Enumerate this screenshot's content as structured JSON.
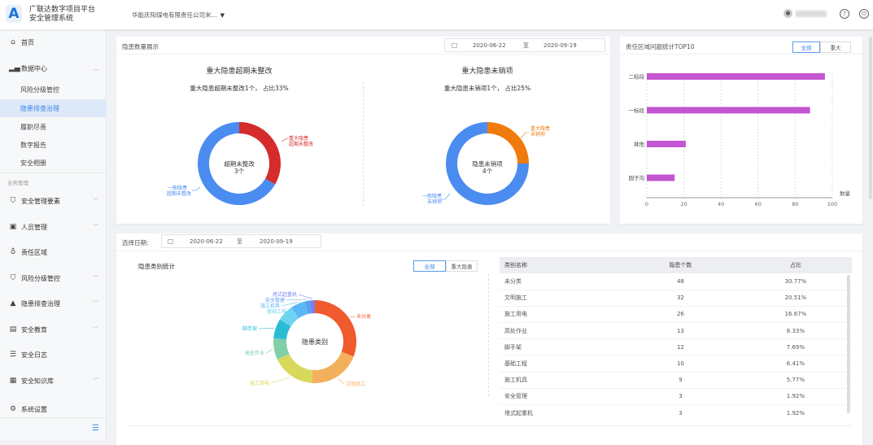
{
  "header": {
    "logo_letter": "A",
    "title_line1": "广联达数字项目平台",
    "title_line2": "安全管理系统",
    "company": "华能庆阳煤电有限责任公司米...",
    "help_icon": "?",
    "power_icon": "⏻"
  },
  "sidebar": {
    "home": "首页",
    "data_center": "数据中心",
    "sub_items": [
      "风险分级管控",
      "隐患排查治理",
      "履职尽责",
      "数字报告",
      "安全相册"
    ],
    "group_label": "业务管理",
    "items": [
      "安全管理要素",
      "人员管理",
      "责任区域",
      "风险分级管控",
      "隐患排查治理",
      "安全教育",
      "安全日志",
      "安全知识库",
      "系统设置"
    ]
  },
  "hazard_display": {
    "title": "隐患数量展示",
    "date_from": "2020-06-22",
    "date_sep": "至",
    "date_to": "2020-09-19",
    "left": {
      "title": "重大隐患超期未整改",
      "summary": "重大隐患超期未整改1个， 占比33%",
      "center_line1": "超期未整改",
      "center_line2": "3个",
      "major_label1": "重大隐患",
      "major_label2": "超期未整改",
      "general_label1": "一般隐患",
      "general_label2": "超期未整改"
    },
    "right": {
      "title": "重大隐患未销项",
      "summary": "重大隐患未销项1个， 占比25%",
      "center_line1": "隐患未销项",
      "center_line2": "4个",
      "major_label1": "重大隐患",
      "major_label2": "未销项",
      "general_label1": "一般隐患",
      "general_label2": "未销项"
    }
  },
  "area_top10": {
    "title": "责任区域问题统计TOP10",
    "seg": [
      "全部",
      "重大"
    ]
  },
  "category": {
    "date_label": "选择日期:",
    "date_from": "2020-06-22",
    "date_sep": "至",
    "date_to": "2020-09-19",
    "title": "隐患类别统计",
    "seg": [
      "全部",
      "重大隐患"
    ],
    "center": "隐患类别",
    "columns": [
      "类别名称",
      "隐患个数",
      "占比"
    ],
    "rows": [
      [
        "未分类",
        "48",
        "30.77%"
      ],
      [
        "文明施工",
        "32",
        "20.51%"
      ],
      [
        "施工用电",
        "26",
        "16.67%"
      ],
      [
        "高处作业",
        "13",
        "8.33%"
      ],
      [
        "脚手架",
        "12",
        "7.69%"
      ],
      [
        "基础工程",
        "10",
        "6.41%"
      ],
      [
        "施工机具",
        "9",
        "5.77%"
      ],
      [
        "安全管理",
        "3",
        "1.92%"
      ],
      [
        "塔式起重机",
        "3",
        "1.92%"
      ]
    ]
  },
  "chart_data": [
    {
      "type": "pie",
      "title": "重大隐患超期未整改",
      "categories": [
        "重大隐患超期未整改",
        "一般隐患超期未整改"
      ],
      "values": [
        1,
        2
      ],
      "colors": [
        "#d42b2b",
        "#4a8cf0"
      ]
    },
    {
      "type": "pie",
      "title": "重大隐患未销项",
      "categories": [
        "重大隐患未销项",
        "一般隐患未销项"
      ],
      "values": [
        1,
        3
      ],
      "colors": [
        "#f07a0c",
        "#4a8cf0"
      ]
    },
    {
      "type": "bar",
      "orientation": "horizontal",
      "title": "责任区域问题统计TOP10",
      "categories": [
        "二标段",
        "一标段",
        "其他",
        "园子沟"
      ],
      "values": [
        96,
        88,
        21,
        15
      ],
      "xlabel": "数量",
      "xlim": [
        0,
        100
      ],
      "xticks": [
        "0",
        "20",
        "40",
        "60",
        "80",
        "100"
      ],
      "color": "#c455d0",
      "grid": true
    },
    {
      "type": "pie",
      "title": "隐患类别统计",
      "categories": [
        "未分类",
        "文明施工",
        "施工用电",
        "高处作业",
        "脚手架",
        "基础工程",
        "施工机具",
        "安全管理",
        "塔式起重机"
      ],
      "values": [
        48,
        32,
        26,
        13,
        12,
        10,
        9,
        3,
        3
      ],
      "colors": [
        "#f05a2d",
        "#f3b05c",
        "#d8d95a",
        "#7fd0a8",
        "#2bbcd4",
        "#6dd4ef",
        "#5ab6f5",
        "#5a9cf5",
        "#7581ee"
      ]
    }
  ]
}
